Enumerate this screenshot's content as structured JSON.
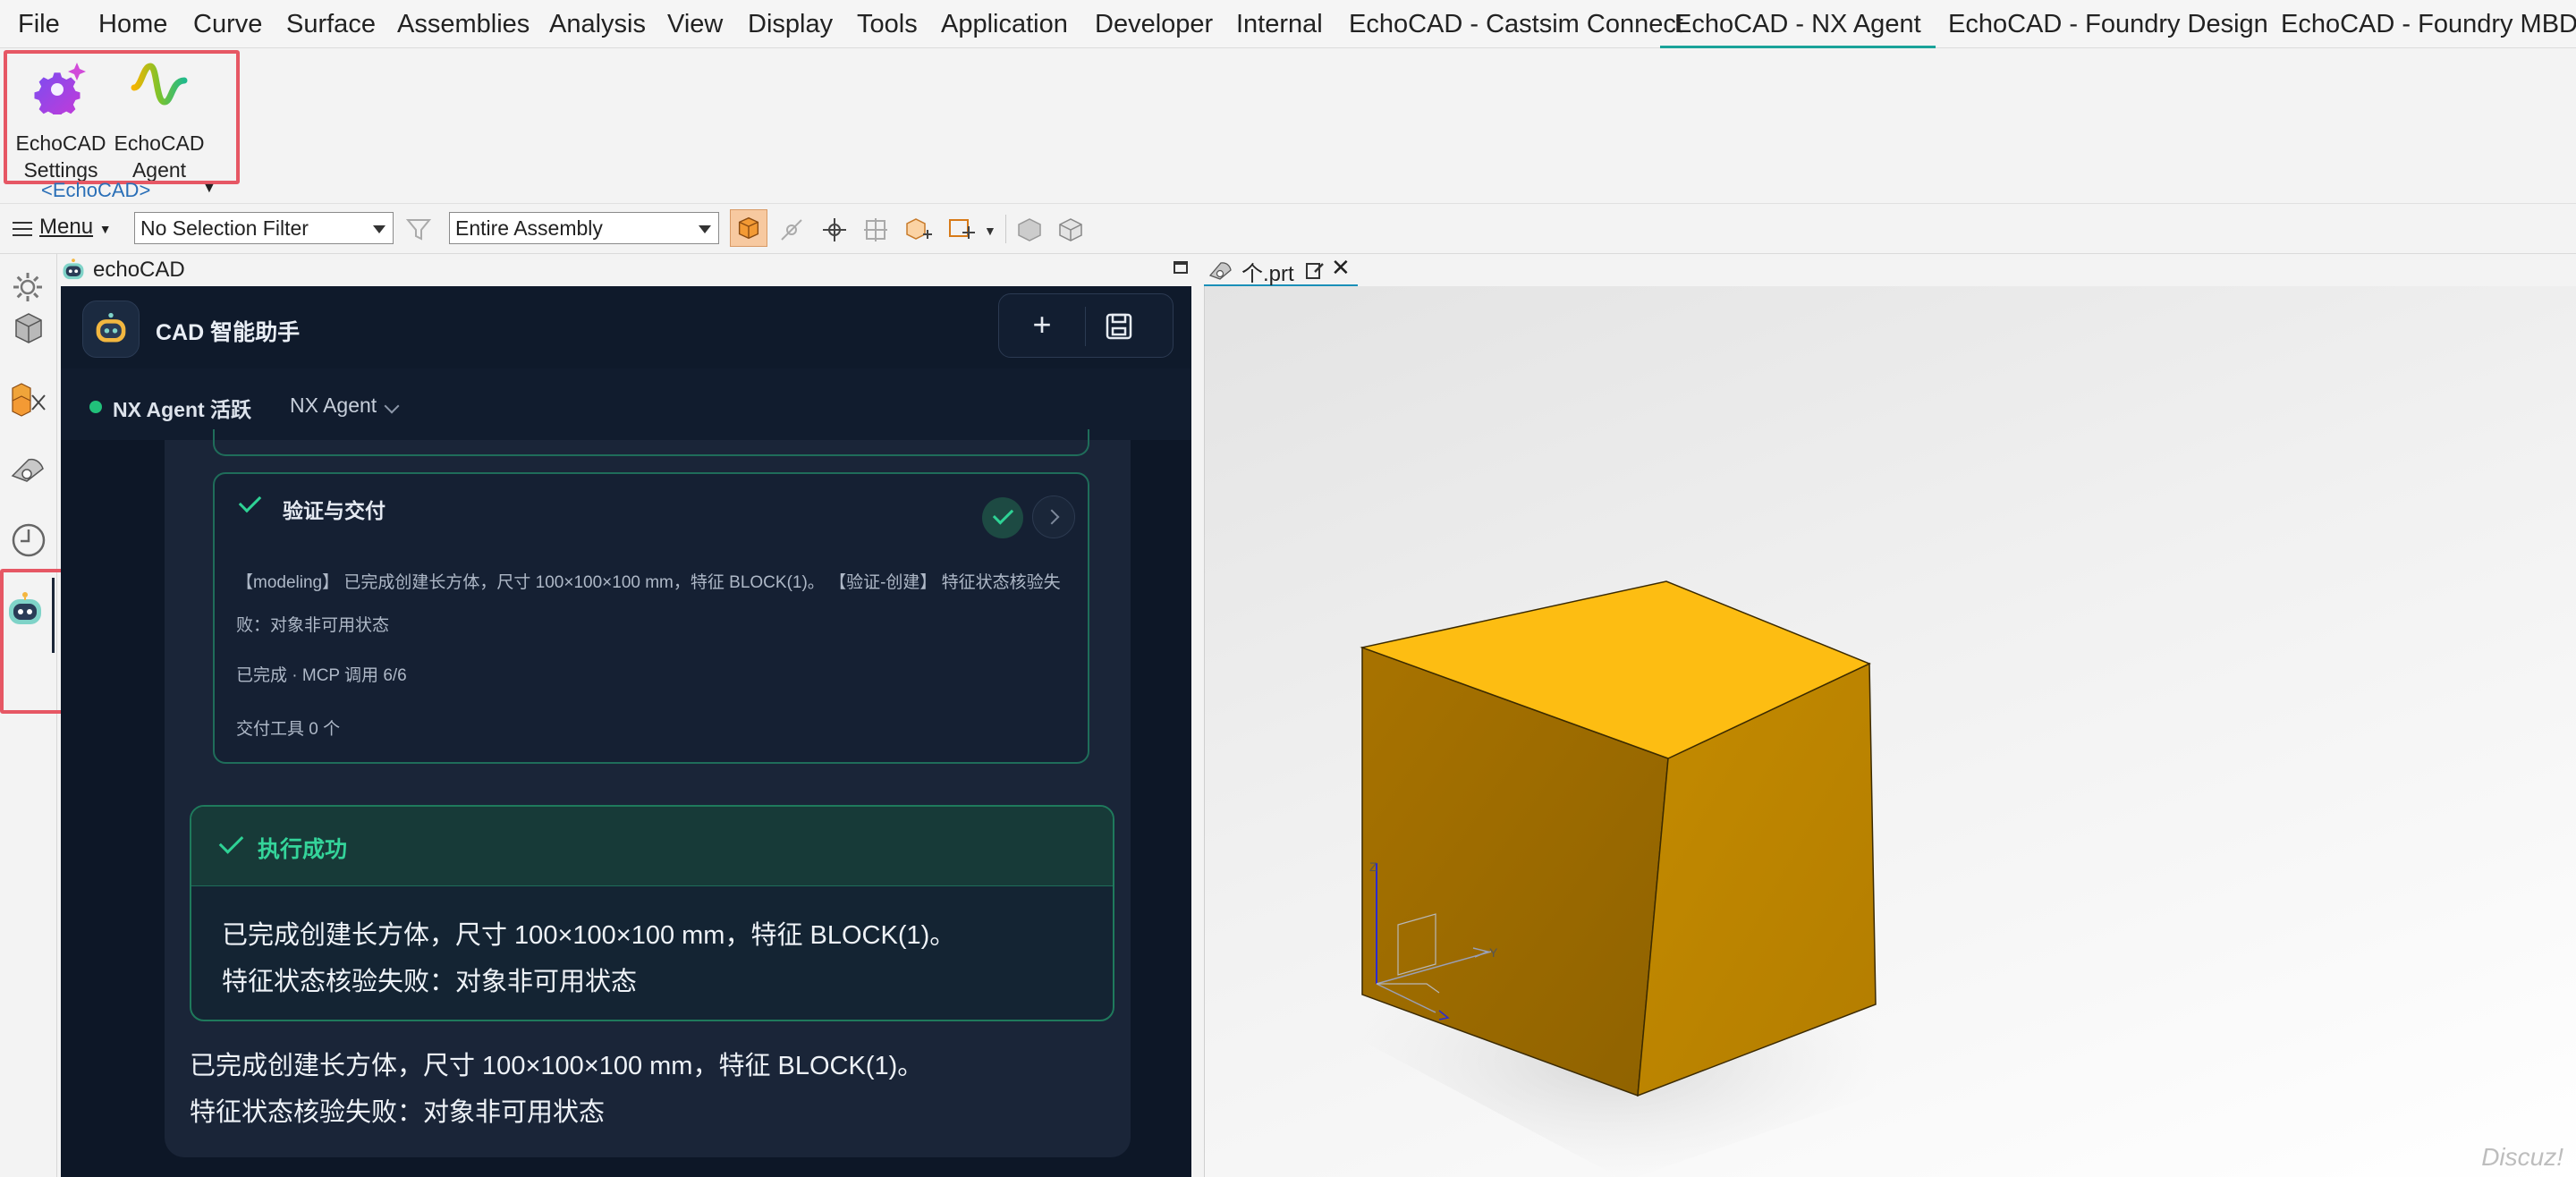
{
  "menubar": {
    "items": [
      {
        "label": "File"
      },
      {
        "label": "Home"
      },
      {
        "label": "Curve"
      },
      {
        "label": "Surface"
      },
      {
        "label": "Assemblies"
      },
      {
        "label": "Analysis"
      },
      {
        "label": "View"
      },
      {
        "label": "Display"
      },
      {
        "label": "Tools"
      },
      {
        "label": "Application"
      },
      {
        "label": "Developer"
      },
      {
        "label": "Internal"
      },
      {
        "label": "EchoCAD - Castsim Connect"
      },
      {
        "label": "EchoCAD - NX Agent"
      },
      {
        "label": "EchoCAD - Foundry Design"
      },
      {
        "label": "EchoCAD - Foundry MBD"
      }
    ],
    "active": "EchoCAD - NX Agent"
  },
  "ribbon": {
    "settings": {
      "line1": "EchoCAD",
      "line2": "Settings"
    },
    "agent": {
      "line1": "EchoCAD",
      "line2": "Agent"
    },
    "group_label": "<EchoCAD>"
  },
  "toolbar": {
    "menu_label": "Menu",
    "selection_filter": "No Selection Filter",
    "scope": "Entire Assembly"
  },
  "panel": {
    "title": "echoCAD"
  },
  "chat": {
    "title": "CAD 智能助手",
    "status": "NX Agent 活跃",
    "agent_select": "NX Agent",
    "verify": {
      "title": "验证与交付",
      "detail_line1": "【modeling】 已完成创建长方体，尺寸 100×100×100 mm，特征 BLOCK(1)。 【验证-创建】 特征状态核验失",
      "detail_line2": "败：对象非可用状态",
      "progress": "已完成 · MCP 调用 6/6",
      "tools": "交付工具 0 个"
    },
    "success": {
      "title": "执行成功",
      "line1": "已完成创建长方体，尺寸 100×100×100 mm，特征 BLOCK(1)。",
      "line2": "特征状态核验失败：对象非可用状态"
    },
    "reply": {
      "line1": "已完成创建长方体，尺寸 100×100×100 mm，特征 BLOCK(1)。",
      "line2": "特征状态核验失败：对象非可用状态"
    }
  },
  "graphics": {
    "tab_name": "个.prt",
    "axis_label_y": "Y",
    "axis_label_z": "Z",
    "watermark": "Discuz!"
  },
  "colors": {
    "accent": "#1aa39a",
    "highlight": "#e65764",
    "chat_bg": "#0d1727",
    "success": "#34d49a",
    "cube_top": "#fdbd12",
    "cube_front": "#b98300"
  }
}
